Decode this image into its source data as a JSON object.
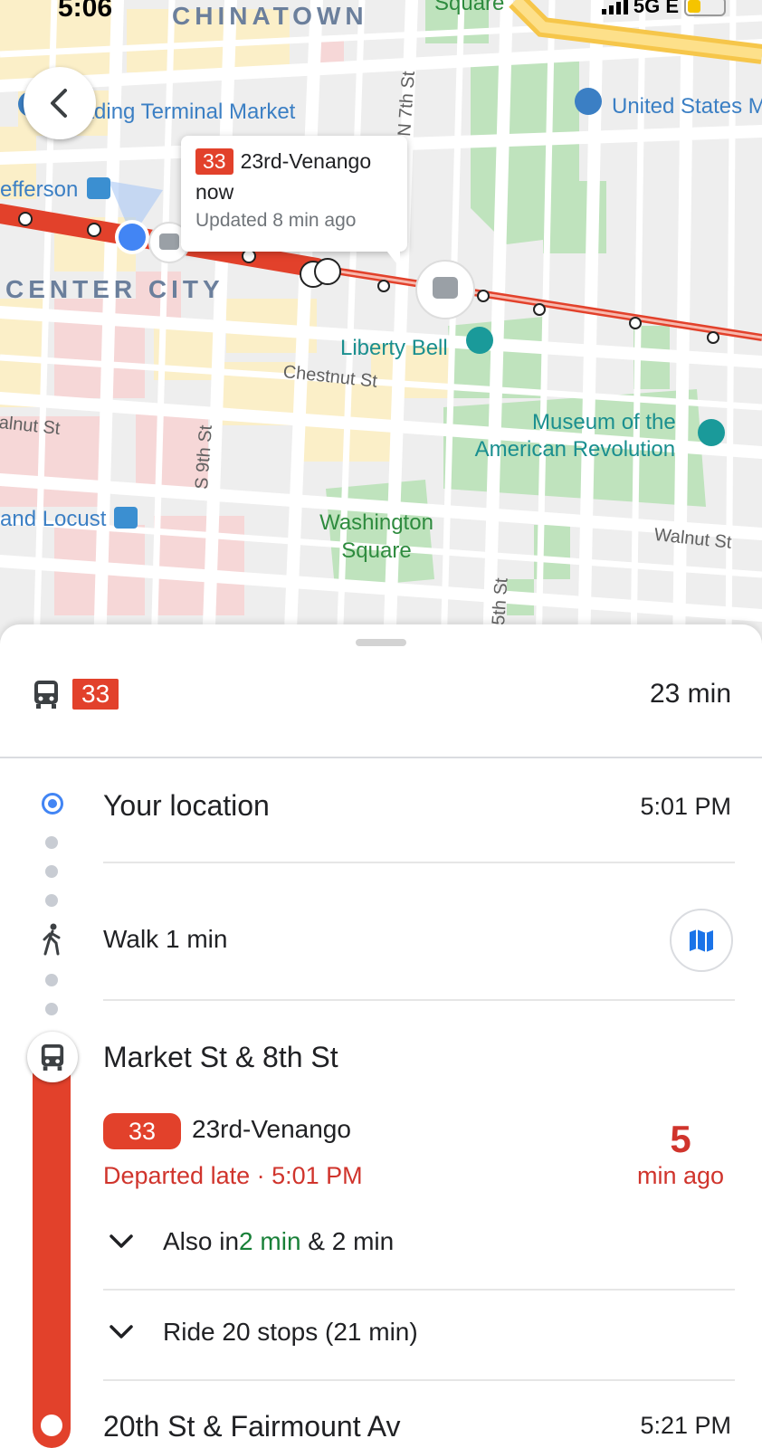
{
  "status_bar": {
    "time": "5:06",
    "network": "5G E"
  },
  "map": {
    "district_labels": [
      "CHINATOWN",
      "CENTER CITY"
    ],
    "poi_labels": {
      "reading_terminal": "Reading Terminal Market",
      "united_states": "United States M",
      "jefferson": "efferson",
      "liberty_bell": "Liberty Bell",
      "museum_line1": "Museum of the",
      "museum_line2": "American Revolution",
      "locust": "and Locust",
      "washington_line1": "Washington",
      "washington_line2": "Square",
      "top_square": "Square"
    },
    "street_labels": {
      "n7th": "N 7th St",
      "chestnut": "Chestnut St",
      "walnut_left": "alnut St",
      "s9th": "S 9th St",
      "walnut_right": "Walnut St",
      "s5th": "5th St"
    },
    "bubble": {
      "route": "33",
      "headsign": "23rd-Venango",
      "status": "now",
      "updated": "Updated 8 min ago"
    }
  },
  "sheet": {
    "summary": {
      "route": "33",
      "duration": "23 min"
    },
    "origin": {
      "title": "Your location",
      "time": "5:01 PM"
    },
    "walk": {
      "label": "Walk 1 min"
    },
    "stop": {
      "title": "Market St & 8th St",
      "route": "33",
      "headsign": "23rd-Venango",
      "departed_label": "Departed late",
      "departed_sep": " · ",
      "departed_time": "5:01 PM",
      "minutes": "5",
      "minutes_unit": "min ago",
      "also_prefix": "Also in ",
      "also_first": "2 min",
      "also_rest": " & 2 min",
      "ride": "Ride 20 stops (21 min)"
    },
    "destination": {
      "title": "20th St & Fairmount Av",
      "time": "5:21 PM"
    }
  },
  "colors": {
    "route": "#e2412b",
    "late": "#d0342c",
    "on_time": "#188038",
    "origin": "#4285f4"
  }
}
